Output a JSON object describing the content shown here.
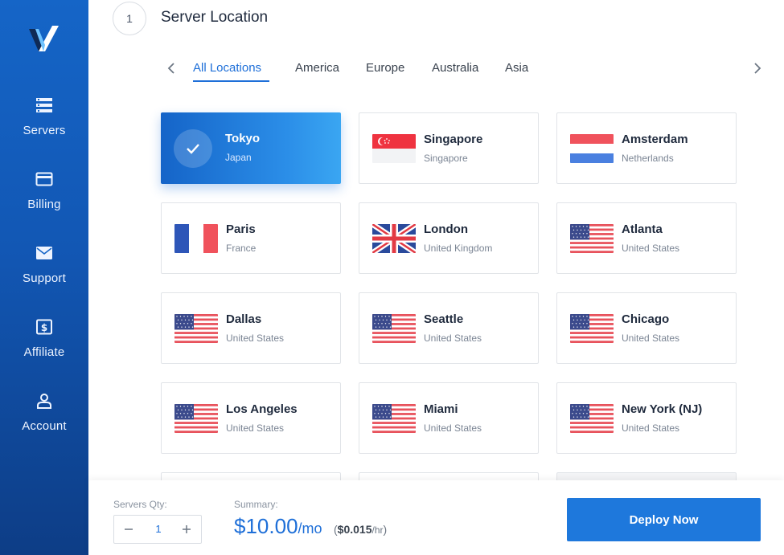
{
  "sidebar": {
    "items": [
      {
        "label": "Servers",
        "icon": "servers-icon"
      },
      {
        "label": "Billing",
        "icon": "credit-card-icon"
      },
      {
        "label": "Support",
        "icon": "envelope-icon"
      },
      {
        "label": "Affiliate",
        "icon": "dollar-icon"
      },
      {
        "label": "Account",
        "icon": "user-icon"
      }
    ]
  },
  "section": {
    "step": "1",
    "title": "Server Location"
  },
  "tabs": [
    {
      "label": "All Locations",
      "active": true
    },
    {
      "label": "America"
    },
    {
      "label": "Europe"
    },
    {
      "label": "Australia"
    },
    {
      "label": "Asia"
    }
  ],
  "locations": [
    {
      "city": "Tokyo",
      "country": "Japan",
      "selected": true
    },
    {
      "city": "Singapore",
      "country": "Singapore",
      "flag": "singapore-flag"
    },
    {
      "city": "Amsterdam",
      "country": "Netherlands",
      "flag": "netherlands-flag"
    },
    {
      "city": "Paris",
      "country": "France",
      "flag": "france-flag"
    },
    {
      "city": "London",
      "country": "United Kingdom",
      "flag": "uk-flag"
    },
    {
      "city": "Atlanta",
      "country": "United States",
      "flag": "us-flag"
    },
    {
      "city": "Dallas",
      "country": "United States",
      "flag": "us-flag"
    },
    {
      "city": "Seattle",
      "country": "United States",
      "flag": "us-flag"
    },
    {
      "city": "Chicago",
      "country": "United States",
      "flag": "us-flag"
    },
    {
      "city": "Los Angeles",
      "country": "United States",
      "flag": "us-flag"
    },
    {
      "city": "Miami",
      "country": "United States",
      "flag": "us-flag"
    },
    {
      "city": "New York (NJ)",
      "country": "United States",
      "flag": "us-flag"
    }
  ],
  "footer": {
    "qty_label": "Servers Qty:",
    "qty_value": "1",
    "summary_label": "Summary:",
    "price": "$10.00",
    "price_period": "/mo",
    "hourly_open": "(",
    "hourly_price": "$0.015",
    "hourly_period": "/hr",
    "hourly_close": ")",
    "deploy_label": "Deploy Now"
  },
  "colors": {
    "accent": "#1e6fd8",
    "sidebar": "#1565c7",
    "deploy": "#1e78dc"
  }
}
